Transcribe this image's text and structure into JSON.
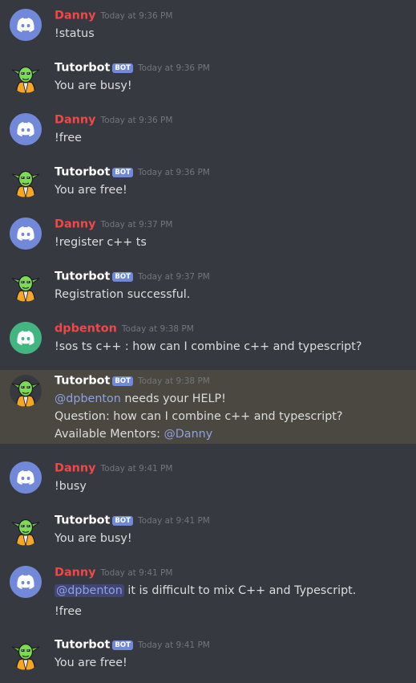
{
  "colors": {
    "background": "#36393f",
    "danny": "#f04747",
    "dpbenton": "#f04747",
    "tutorbot": "#ffffff",
    "avatar_blurple": "#7289da",
    "avatar_green": "#43b581",
    "mention": "#8ea1e1",
    "highlight": "#4a4840"
  },
  "bot_label": "BOT",
  "messages": [
    {
      "author": "Danny",
      "avatar": "discord-blurple",
      "time": "Today at 9:36 PM",
      "lines": [
        {
          "text": "!status"
        }
      ]
    },
    {
      "author": "Tutorbot",
      "avatar": "yoda",
      "bot": true,
      "time": "Today at 9:36 PM",
      "lines": [
        {
          "text": "You are busy!"
        }
      ]
    },
    {
      "author": "Danny",
      "avatar": "discord-blurple",
      "time": "Today at 9:36 PM",
      "lines": [
        {
          "text": "!free"
        }
      ]
    },
    {
      "author": "Tutorbot",
      "avatar": "yoda",
      "bot": true,
      "time": "Today at 9:36 PM",
      "lines": [
        {
          "text": "You are free!"
        }
      ]
    },
    {
      "author": "Danny",
      "avatar": "discord-blurple",
      "time": "Today at 9:37 PM",
      "lines": [
        {
          "text": "!register c++ ts"
        }
      ]
    },
    {
      "author": "Tutorbot",
      "avatar": "yoda",
      "bot": true,
      "time": "Today at 9:37 PM",
      "lines": [
        {
          "text": "Registration successful."
        }
      ]
    },
    {
      "author": "dpbenton",
      "avatar": "discord-green",
      "time": "Today at 9:38 PM",
      "lines": [
        {
          "text": "!sos ts c++ : how can I combine c++ and typescript?"
        }
      ]
    },
    {
      "author": "Tutorbot",
      "avatar": "yoda",
      "bot": true,
      "highlight": true,
      "time": "Today at 9:38 PM",
      "lines": [
        {
          "mention": "@dpbenton",
          "text": " needs your HELP!"
        },
        {
          "text": "Question: how can I combine c++ and typescript?"
        },
        {
          "text": "Available Mentors: ",
          "mention_after": "@Danny"
        }
      ]
    },
    {
      "author": "Danny",
      "avatar": "discord-blurple",
      "time": "Today at 9:41 PM",
      "lines": [
        {
          "text": "!busy"
        }
      ]
    },
    {
      "author": "Tutorbot",
      "avatar": "yoda",
      "bot": true,
      "time": "Today at 9:41 PM",
      "lines": [
        {
          "text": "You are busy!"
        }
      ]
    },
    {
      "author": "Danny",
      "avatar": "discord-blurple",
      "time": "Today at 9:41 PM",
      "lines": [
        {
          "mention": "@dpbenton",
          "mention_style": "bg",
          "text": " it is difficult to mix C++ and Typescript."
        },
        {
          "gap": true
        },
        {
          "text": "!free"
        }
      ]
    },
    {
      "author": "Tutorbot",
      "avatar": "yoda",
      "bot": true,
      "time": "Today at 9:41 PM",
      "lines": [
        {
          "text": "You are free!"
        }
      ]
    }
  ]
}
